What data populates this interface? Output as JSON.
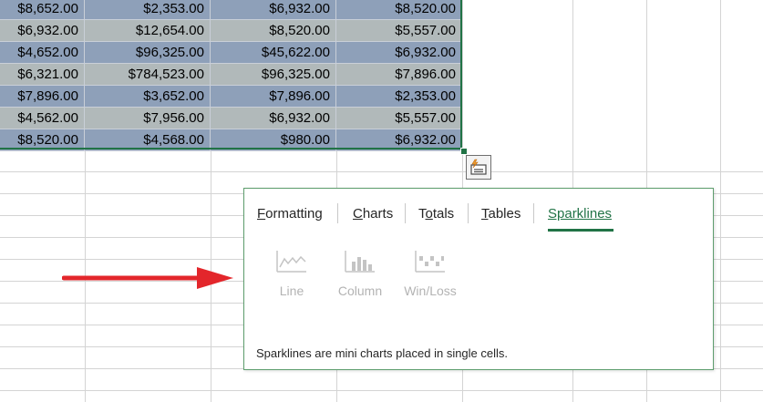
{
  "spreadsheet": {
    "rows": [
      [
        "$8,652.00",
        "$2,353.00",
        "$6,932.00",
        "$8,520.00"
      ],
      [
        "$6,932.00",
        "$12,654.00",
        "$8,520.00",
        "$5,557.00"
      ],
      [
        "$4,652.00",
        "$96,325.00",
        "$45,622.00",
        "$6,932.00"
      ],
      [
        "$6,321.00",
        "$784,523.00",
        "$96,325.00",
        "$7,896.00"
      ],
      [
        "$7,896.00",
        "$3,652.00",
        "$7,896.00",
        "$2,353.00"
      ],
      [
        "$4,562.00",
        "$7,956.00",
        "$6,932.00",
        "$5,557.00"
      ],
      [
        "$8,520.00",
        "$4,568.00",
        "$980.00",
        "$6,932.00"
      ]
    ],
    "band_colors": {
      "dark": "#8ea0b9",
      "light": "#b1b9ba"
    }
  },
  "quick_analysis": {
    "button_icon": "quick-analysis-icon",
    "tabs": [
      {
        "label": "Formatting",
        "access_key": "F"
      },
      {
        "label": "Charts",
        "access_key": "C"
      },
      {
        "label": "Totals",
        "access_key": "o"
      },
      {
        "label": "Tables",
        "access_key": "T"
      },
      {
        "label": "Sparklines",
        "access_key": "S",
        "selected": true
      }
    ],
    "options": [
      {
        "label": "Line",
        "icon": "sparkline-line-icon",
        "enabled": false
      },
      {
        "label": "Column",
        "icon": "sparkline-column-icon",
        "enabled": false
      },
      {
        "label": "Win/Loss",
        "icon": "sparkline-winloss-icon",
        "enabled": false
      }
    ],
    "description": "Sparklines are mini charts placed in single cells.",
    "accent_color": "#217346"
  },
  "annotation": {
    "icon": "red-arrow-icon",
    "color": "#e3262b"
  }
}
